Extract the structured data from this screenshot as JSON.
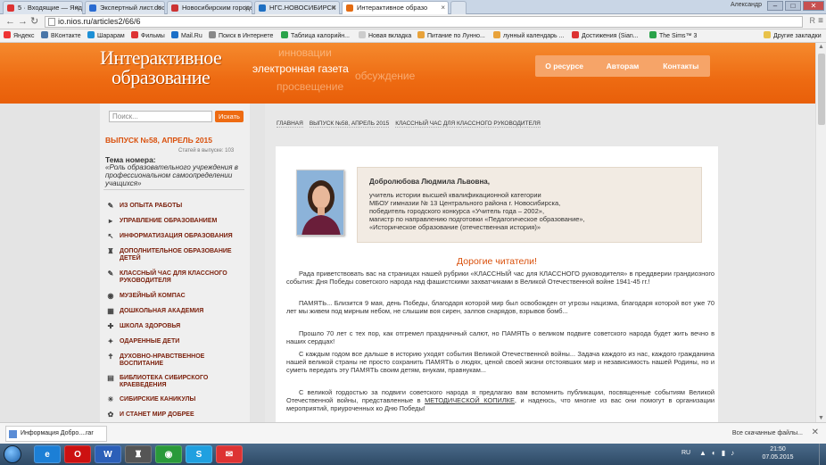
{
  "browser": {
    "tabs": [
      {
        "label": "5 · Входящие — Яндекс.",
        "color": "#d33"
      },
      {
        "label": "Экспертный лист.docx",
        "color": "#2a6bd1"
      },
      {
        "label": "Новосибирским городе",
        "color": "#c33"
      },
      {
        "label": "НГС.НОВОСИБИРСК",
        "color": "#1e6fc2"
      },
      {
        "label": "Интерактивное образо",
        "color": "#e36b12"
      }
    ],
    "user": "Александр",
    "window_controls": [
      "–",
      "□",
      "✕"
    ],
    "url": "io.nios.ru/articles2/66/6",
    "reader_btn": "R",
    "menu_btn": "≡",
    "bookmarks": [
      {
        "label": "Яндекс",
        "icon": "Я",
        "color": "#e33"
      },
      {
        "label": "ВКонтакте",
        "icon": "В",
        "color": "#4a76a8"
      },
      {
        "label": "Шарарам",
        "icon": "Ш",
        "color": "#1e90d6"
      },
      {
        "label": "Фильмы",
        "icon": "Ф",
        "color": "#d33"
      },
      {
        "label": "Mail.Ru",
        "icon": "@",
        "color": "#1b6fc7"
      },
      {
        "label": "Поиск в Интернете",
        "icon": "П",
        "color": "#555"
      },
      {
        "label": "Таблица калорийн...",
        "icon": "C",
        "color": "#2aa34a"
      },
      {
        "label": "Новая вкладка",
        "icon": "",
        "color": "#999"
      },
      {
        "label": "Питание по Лунно...",
        "icon": "",
        "color": "#e8a23a"
      },
      {
        "label": "лунный календарь ...",
        "icon": "",
        "color": "#e8a23a"
      },
      {
        "label": "Достижения (Sian...",
        "icon": "",
        "color": "#d33"
      },
      {
        "label": "The Sims™ 3",
        "icon": "",
        "color": "#2aa34a"
      }
    ],
    "other_bookmarks": "Другие закладки"
  },
  "site": {
    "logo_line1": "Интерактивное",
    "logo_line2": "образование",
    "tagline": "электронная газета",
    "ghost_words": [
      "инновации",
      "обсуждение",
      "просвещение"
    ],
    "topnav": [
      "О ресурсе",
      "Авторам",
      "Контакты"
    ],
    "search_placeholder": "Поиск...",
    "search_button": "Искать",
    "issue": "ВЫПУСК №58, АПРЕЛЬ 2015",
    "articles_count": "Статей в выпуске: 103",
    "theme_label": "Тема номера:",
    "theme_value": "«Роль образовательного учреждения в профессиональном самоопределении учащихся»",
    "categories": [
      {
        "label": "ИЗ ОПЫТА РАБОТЫ",
        "icon": "✎"
      },
      {
        "label": "УПРАВЛЕНИЕ ОБРАЗОВАНИЕМ",
        "icon": "▸"
      },
      {
        "label": "ИНФОРМАТИЗАЦИЯ ОБРАЗОВАНИЯ",
        "icon": "↖"
      },
      {
        "label": "ДОПОЛНИТЕЛЬНОЕ ОБРАЗОВАНИЕ ДЕТЕЙ",
        "icon": "♜"
      },
      {
        "label": "КЛАССНЫЙ ЧАС ДЛЯ КЛАССНОГО РУКОВОДИТЕЛЯ",
        "icon": "✎"
      },
      {
        "label": "МУЗЕЙНЫЙ КОМПАС",
        "icon": "◉"
      },
      {
        "label": "ДОШКОЛЬНАЯ АКАДЕМИЯ",
        "icon": "▦"
      },
      {
        "label": "ШКОЛА ЗДОРОВЬЯ",
        "icon": "✚"
      },
      {
        "label": "ОДАРЕННЫЕ ДЕТИ",
        "icon": "✦"
      },
      {
        "label": "ДУХОВНО-НРАВСТВЕННОЕ ВОСПИТАНИЕ",
        "icon": "✝"
      },
      {
        "label": "БИБЛИОТЕКА СИБИРСКОГО КРАЕВЕДЕНИЯ",
        "icon": "▤"
      },
      {
        "label": "СИБИРСКИЕ КАНИКУЛЫ",
        "icon": "☀"
      },
      {
        "label": "И СТАНЕТ МИР ДОБРЕЕ",
        "icon": "✿"
      }
    ],
    "breadcrumbs": [
      "ГЛАВНАЯ",
      "ВЫПУСК №58, АПРЕЛЬ 2015",
      "КЛАССНЫЙ ЧАС ДЛЯ КЛАССНОГО РУКОВОДИТЕЛЯ"
    ],
    "author": {
      "name": "Добролюбова Людмила Львовна,",
      "lines": [
        "учитель истории высшей квалификационной категории",
        "МБОУ гимназии № 13 Центрального района г. Новосибирска,",
        "победитель городского конкурса «Учитель года – 2002»,",
        "магистр по направлению подготовки «Педагогическое образование»,",
        "«Историческое образование (отечественная история)»"
      ]
    },
    "greeting": "Дорогие читатели!",
    "paragraphs": [
      "Рада приветствовать вас на страницах нашей рубрики «КЛАССНЫЙ час для КЛАССНОГО руководителя» в преддверии грандиозного события: Дня Победы советского народа над фашистскими захватчиками в Великой Отечественной войне 1941-45 гг.!",
      "ПАМЯТЬ... Близится 9 мая, день Победы, благодаря которой мир был освобожден от угрозы нацизма, благодаря которой вот уже 70 лет мы живем под мирным небом, не слышим воя сирен, залпов снарядов, взрывов бомб...",
      "Прошло 70 лет с тех пор, как отгремел праздничный салют, но ПАМЯТЬ о великом подвиге советского народа будет жить вечно в наших сердцах!",
      "С каждым годом все дальше в историю уходят события Великой Отечественной войны... Задача каждого из нас, каждого гражданина нашей великой страны не просто сохранить ПАМЯТЬ о людях, ценой своей жизни отстоявших мир и независимость нашей Родины, но и суметь передать эту ПАМЯТЬ своим детям, внукам, правнукам..."
    ],
    "para5_a": "С великой гордостью за подвиги советского народа я предлагаю вам вспомнить публикации, посвященные событиям Великой Отечественной войны, представленные в ",
    "para5_link": "МЕТОДИЧЕСКОЙ КОПИЛКЕ",
    "para5_b": ", и надеюсь, что многие из вас они помогут в организации мероприятий, приуроченных ко Дню Победы!"
  },
  "downloads": {
    "item": "Информация Добро....rar",
    "show_all": "Все скачанные файлы...",
    "close": "✕"
  },
  "taskbar": {
    "apps": [
      {
        "label": "e",
        "color": "#1c7fd6"
      },
      {
        "label": "O",
        "color": "#cc1111"
      },
      {
        "label": "W",
        "color": "#2b5fb8"
      },
      {
        "label": "♜",
        "color": "#555"
      },
      {
        "label": "◉",
        "color": "#2a9a3a"
      },
      {
        "label": "S",
        "color": "#1fa0e0"
      },
      {
        "label": "✉",
        "color": "#d33"
      }
    ],
    "lang": "RU",
    "time": "21:50",
    "date": "07.05.2015"
  }
}
